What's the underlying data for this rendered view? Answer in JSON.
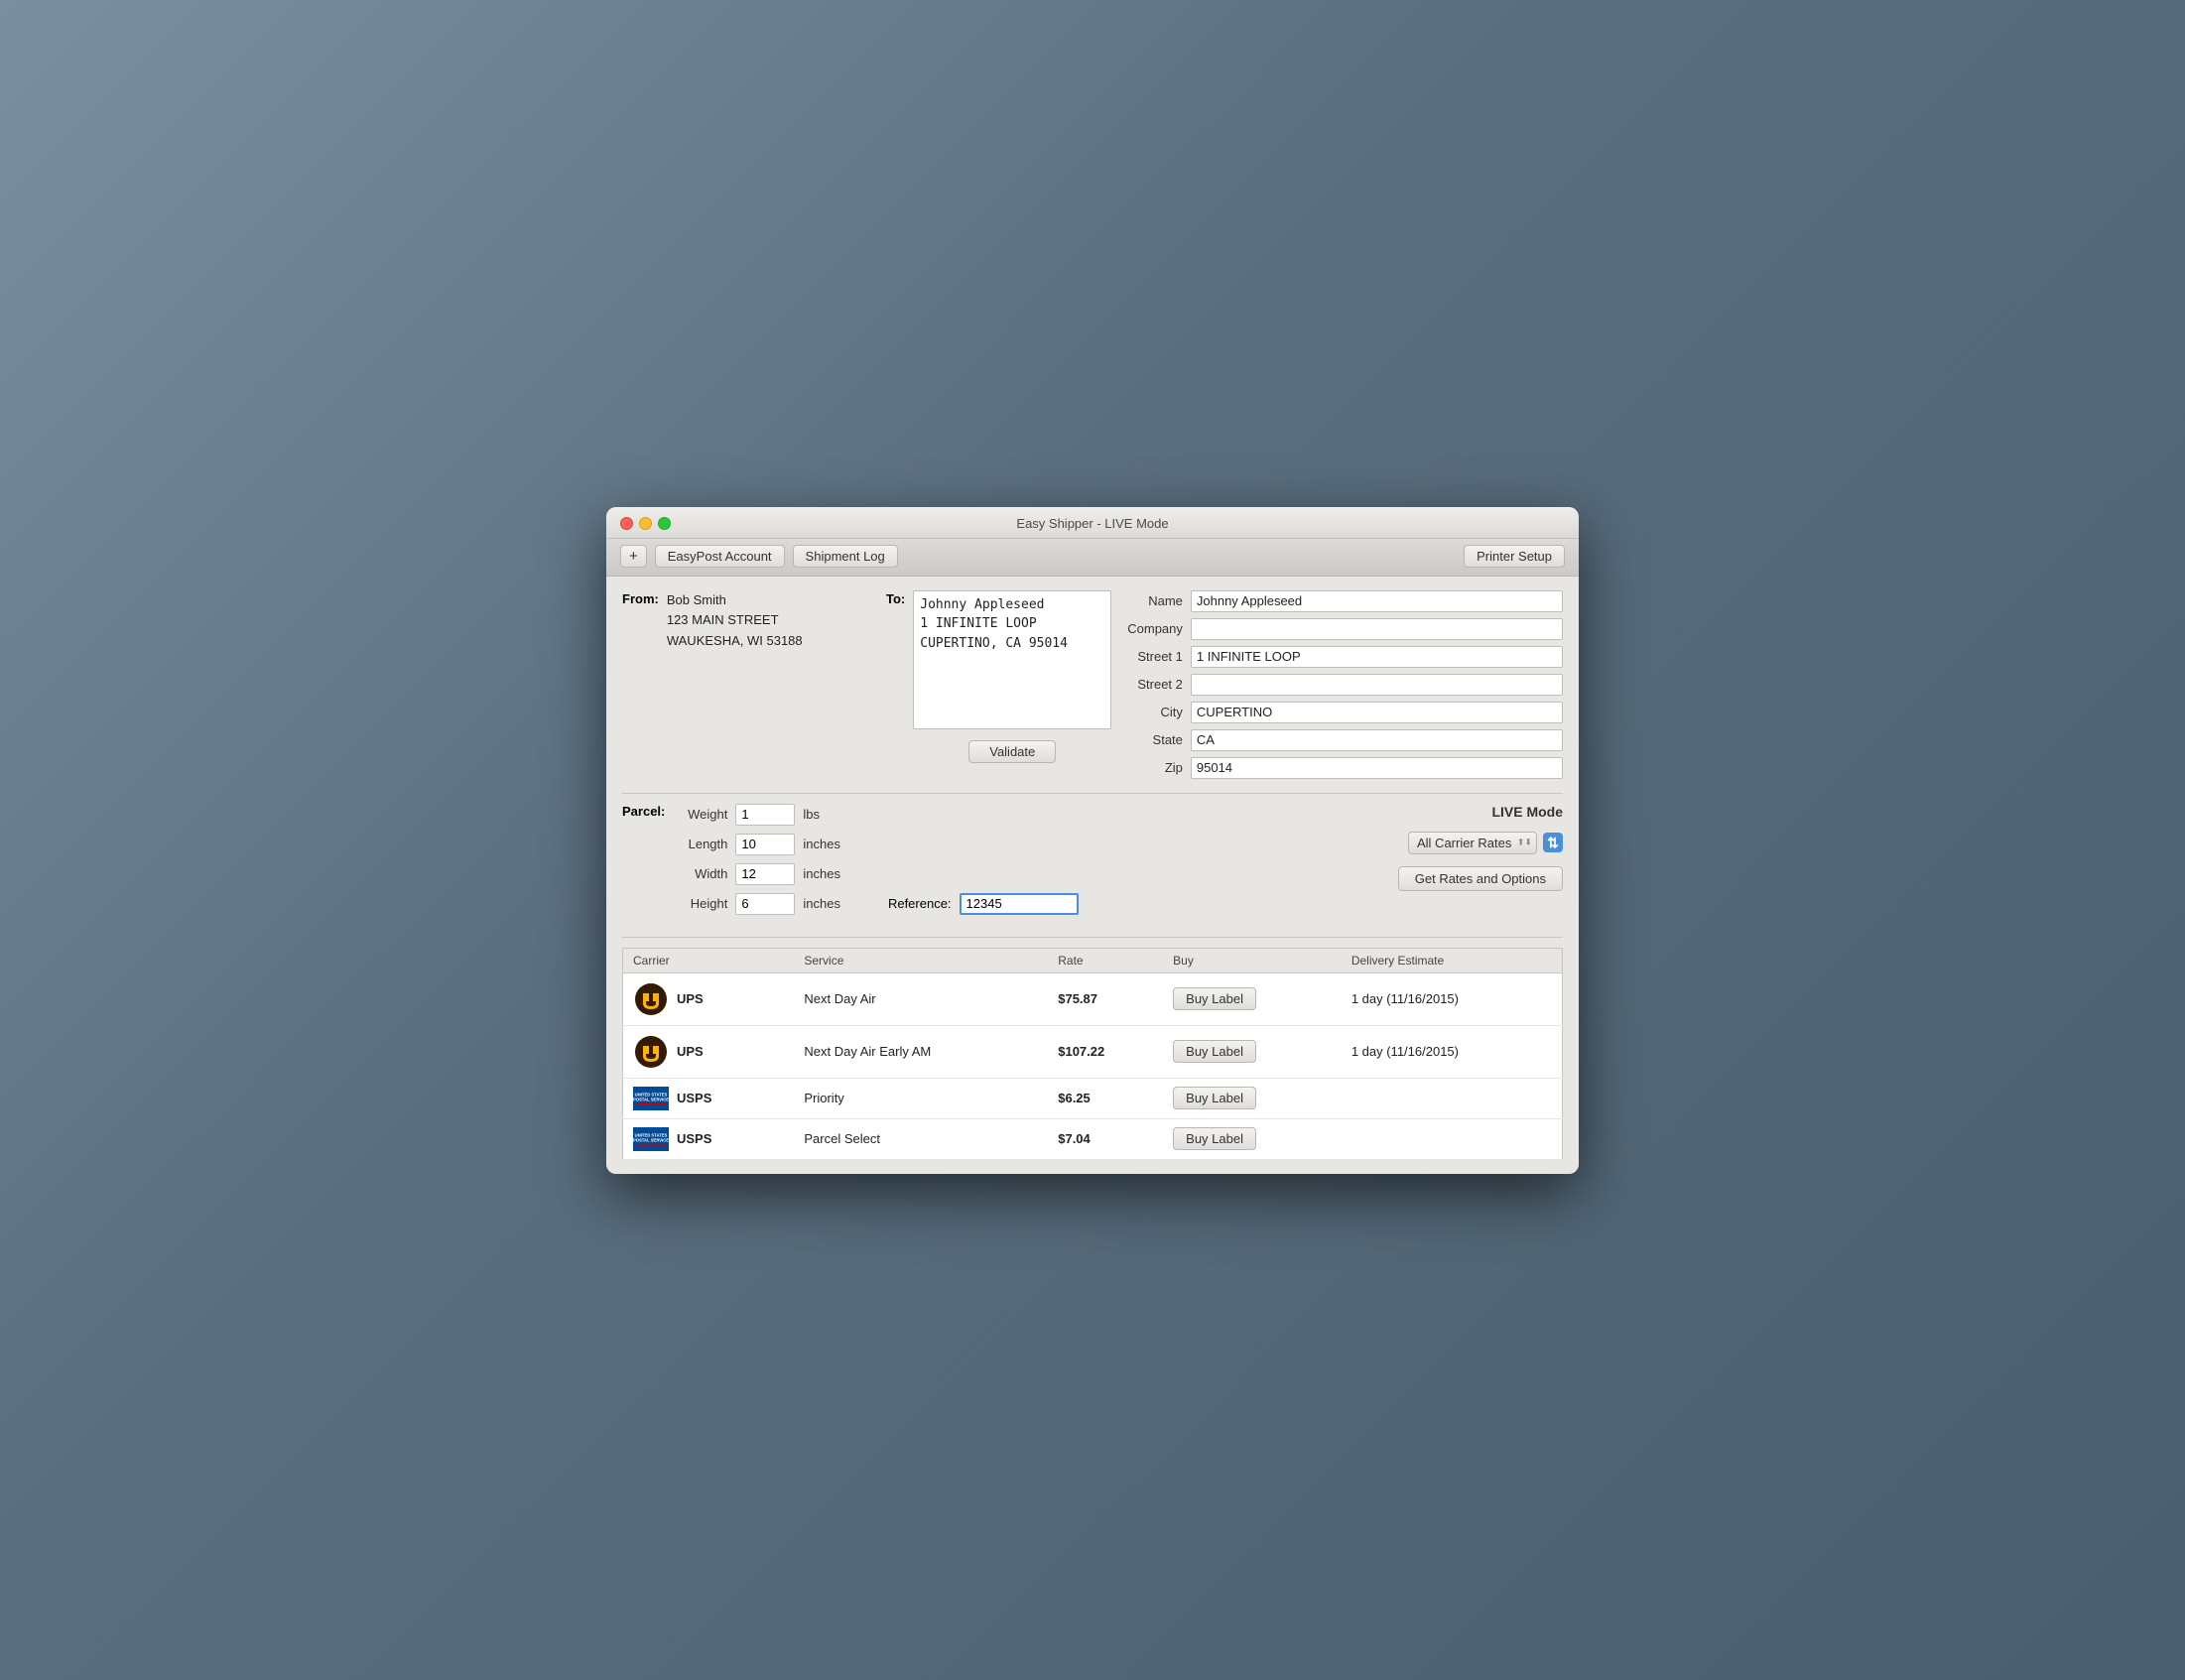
{
  "window": {
    "title": "Easy Shipper - LIVE Mode"
  },
  "toolbar": {
    "add_label": "+",
    "easypost_label": "EasyPost Account",
    "shipment_log_label": "Shipment Log",
    "printer_setup_label": "Printer Setup"
  },
  "from": {
    "label": "From:",
    "name": "Bob Smith",
    "street": "123 MAIN STREET",
    "city_state_zip": "WAUKESHA, WI 53188"
  },
  "to": {
    "label": "To:",
    "textarea_value": "Johnny Appleseed\n1 INFINITE LOOP\nCUPERTINO, CA 95014"
  },
  "address_form": {
    "name_label": "Name",
    "name_value": "Johnny Appleseed",
    "company_label": "Company",
    "company_value": "",
    "street1_label": "Street 1",
    "street1_value": "1 INFINITE LOOP",
    "street2_label": "Street 2",
    "street2_value": "",
    "city_label": "City",
    "city_value": "CUPERTINO",
    "state_label": "State",
    "state_value": "CA",
    "zip_label": "Zip",
    "zip_value": "95014",
    "validate_label": "Validate"
  },
  "parcel": {
    "label": "Parcel:",
    "weight_label": "Weight",
    "weight_value": "1",
    "weight_unit": "lbs",
    "length_label": "Length",
    "length_value": "10",
    "length_unit": "inches",
    "width_label": "Width",
    "width_value": "12",
    "width_unit": "inches",
    "height_label": "Height",
    "height_value": "6",
    "height_unit": "inches",
    "reference_label": "Reference:",
    "reference_value": "12345"
  },
  "rates_panel": {
    "live_mode_label": "LIVE Mode",
    "carrier_rates_label": "All Carrier Rates",
    "get_rates_label": "Get Rates and Options"
  },
  "rates_table": {
    "headers": [
      "Carrier",
      "Service",
      "Rate",
      "Buy",
      "Delivery Estimate"
    ],
    "rows": [
      {
        "carrier": "UPS",
        "carrier_type": "ups",
        "service": "Next Day Air",
        "rate": "$75.87",
        "buy_label": "Buy Label",
        "delivery": "1 day (11/16/2015)"
      },
      {
        "carrier": "UPS",
        "carrier_type": "ups",
        "service": "Next Day Air Early AM",
        "rate": "$107.22",
        "buy_label": "Buy Label",
        "delivery": "1 day (11/16/2015)"
      },
      {
        "carrier": "USPS",
        "carrier_type": "usps",
        "service": "Priority",
        "rate": "$6.25",
        "buy_label": "Buy Label",
        "delivery": ""
      },
      {
        "carrier": "USPS",
        "carrier_type": "usps",
        "service": "Parcel Select",
        "rate": "$7.04",
        "buy_label": "Buy Label",
        "delivery": ""
      }
    ]
  }
}
